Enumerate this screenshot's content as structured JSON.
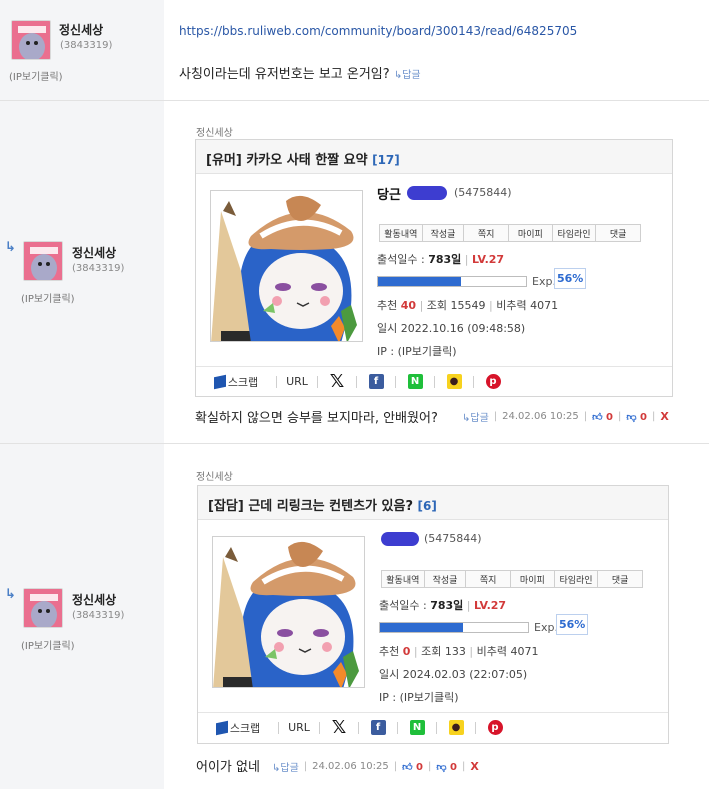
{
  "comments": [
    {
      "nick": "정신세상",
      "user_no": "(3843319)",
      "ip": "(IP보기클릭)",
      "link": "https://bbs.ruliweb.com/community/board/300143/read/64825705",
      "text": "사칭이라는데 유저번호는 보고 온거임?",
      "reply_label": "↳답글"
    },
    {
      "nick": "정신세상",
      "user_no": "(3843319)",
      "ip": "(IP보기클릭)",
      "source_name": "정신세상",
      "card": {
        "tag": "[유머]",
        "title": "카카오 사태 한짤 요약",
        "count": "[17]",
        "profile_name": "당근",
        "profile_id": "(5475844)",
        "menu": [
          "활동내역",
          "작성글",
          "쪽지",
          "마이피",
          "타임라인",
          "댓글"
        ],
        "attendance_label": "출석일수 : ",
        "attendance": "783일",
        "level": "LV.27",
        "exp_label": "Exp.",
        "exp_pct": "56%",
        "exp_fraction": 0.56,
        "recommend_label": "추천",
        "recommend": "40",
        "views_label": "조회",
        "views": "15549",
        "ratio_label": "비추력",
        "ratio": "4071",
        "date_label": "일시",
        "date": "2022.10.16",
        "time": "(09:48:58)",
        "ip_label": "IP :",
        "ip_value": "(IP보기클릭)"
      },
      "text": "확실하지 않으면 승부를 보지마라, 안배웠어?",
      "reply_label": "↳답글",
      "timestamp": "24.02.06 10:25",
      "up": "0",
      "down": "0",
      "delete": "X"
    },
    {
      "nick": "정신세상",
      "user_no": "(3843319)",
      "ip": "(IP보기클릭)",
      "source_name": "정신세상",
      "card": {
        "tag": "[잡담]",
        "title": "근데 리링크는 컨텐츠가 있음?",
        "count": "[6]",
        "profile_name": "",
        "profile_id": "(5475844)",
        "menu": [
          "활동내역",
          "작성글",
          "쪽지",
          "마이피",
          "타임라인",
          "댓글"
        ],
        "attendance_label": "출석일수 : ",
        "attendance": "783일",
        "level": "LV.27",
        "exp_label": "Exp.",
        "exp_pct": "56%",
        "exp_fraction": 0.56,
        "recommend_label": "추천",
        "recommend": "0",
        "views_label": "조회",
        "views": "133",
        "ratio_label": "비추력",
        "ratio": "4071",
        "date_label": "일시",
        "date": "2024.02.03",
        "time": "(22:07:05)",
        "ip_label": "IP :",
        "ip_value": "(IP보기클릭)"
      },
      "text": "어이가 없네",
      "reply_label": "↳답글",
      "timestamp": "24.02.06 10:25",
      "up": "0",
      "down": "0",
      "delete": "X"
    }
  ],
  "share": {
    "scrap": "스크랩",
    "url": "URL",
    "x_icon": "x-logo-icon",
    "facebook_icon": "facebook-icon",
    "naver_icon": "naver-icon",
    "kakao_icon": "kakaotalk-icon",
    "pinterest_icon": "pinterest-icon"
  },
  "colors": {
    "link": "#2a57a6",
    "accent_blue": "#2e6bd0",
    "accent_red": "#d23a3a",
    "left_bg": "#f4f5f7"
  }
}
